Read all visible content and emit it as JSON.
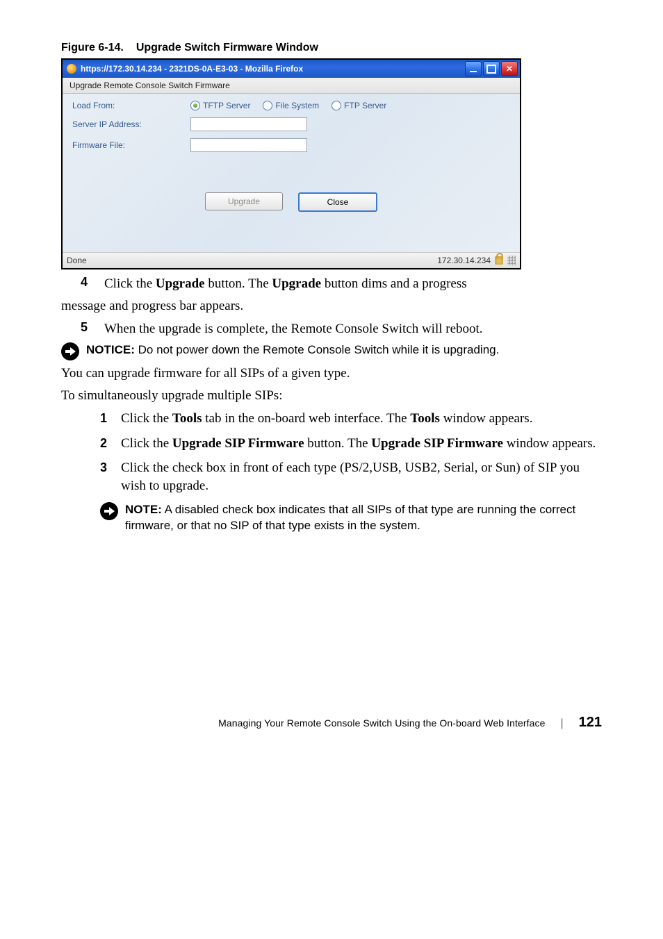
{
  "figure": {
    "label": "Figure 6-14.",
    "title": "Upgrade Switch Firmware Window"
  },
  "dialog": {
    "titlebar": "https://172.30.14.234 - 2321DS-0A-E3-03 - Mozilla Firefox",
    "subheader": "Upgrade Remote Console Switch Firmware",
    "labels": {
      "load_from": "Load From:",
      "server_ip": "Server IP Address:",
      "firmware_file": "Firmware File:"
    },
    "radios": {
      "tftp": "TFTP Server",
      "filesystem": "File System",
      "ftp": "FTP Server"
    },
    "buttons": {
      "upgrade": "Upgrade",
      "close": "Close"
    },
    "status": {
      "left": "Done",
      "ip": "172.30.14.234"
    }
  },
  "content": {
    "step4_num": "4",
    "step4": "Click the Upgrade button. The Upgrade button dims and a progress",
    "step4_cont": "message and progress bar appears.",
    "step5_num": "5",
    "step5": "When the upgrade is complete, the Remote Console Switch will reboot.",
    "notice_label": "NOTICE:",
    "notice_text": " Do not power down the Remote Console Switch while it is upgrading.",
    "para_upgrade_all": "You can upgrade firmware for all SIPs of a given type.",
    "para_simul": "To simultaneously upgrade multiple SIPs:",
    "list": {
      "n1": "1",
      "t1a": "Click the ",
      "t1b": "Tools",
      "t1c": " tab in the on-board web interface. The ",
      "t1d": "Tools",
      "t1e": " window appears.",
      "n2": "2",
      "t2a": "Click the ",
      "t2b": "Upgrade SIP Firmware",
      "t2c": " button. The ",
      "t2d": "Upgrade SIP Firmware",
      "t2e": " window appears.",
      "n3": "3",
      "t3": "Click the check box in front of each type (PS/2,USB, USB2, Serial, or Sun) of SIP you wish to upgrade."
    },
    "note_label": "NOTE:",
    "note_text": " A disabled check box indicates that all SIPs of that type are running the correct firmware, or that no SIP of that type exists in the system."
  },
  "footer": {
    "text": "Managing Your Remote Console Switch Using the On-board Web Interface",
    "page": "121"
  }
}
